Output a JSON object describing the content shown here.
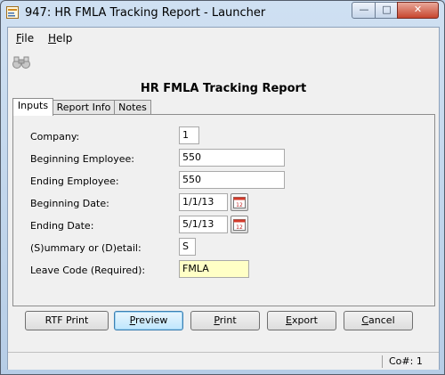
{
  "window": {
    "title": "947: HR FMLA Tracking Report - Launcher",
    "min_glyph": "—",
    "max_glyph": "□",
    "close_glyph": "✕"
  },
  "menu": {
    "file": {
      "key": "F",
      "rest": "ile"
    },
    "help": {
      "key": "H",
      "rest": "elp"
    }
  },
  "report_title": "HR FMLA Tracking Report",
  "tabs": [
    {
      "label": "Inputs"
    },
    {
      "label": "Report Info"
    },
    {
      "label": "Notes"
    }
  ],
  "inputs": {
    "company": {
      "label": "Company:",
      "value": "1"
    },
    "beginning_employee": {
      "label": "Beginning Employee:",
      "value": "550"
    },
    "ending_employee": {
      "label": "Ending Employee:",
      "value": "550"
    },
    "beginning_date": {
      "label": "Beginning Date:",
      "value": "1/1/13"
    },
    "ending_date": {
      "label": "Ending Date:",
      "value": "5/1/13"
    },
    "summary_detail": {
      "label": "(S)ummary or (D)etail:",
      "value": "S"
    },
    "leave_code": {
      "label": "Leave Code (Required):",
      "value": "FMLA"
    }
  },
  "buttons": {
    "rtf_print": {
      "label": "RTF Print"
    },
    "preview": {
      "key": "P",
      "rest": "review"
    },
    "print": {
      "key": "P",
      "rest": "rint"
    },
    "export": {
      "key": "E",
      "rest": "xport"
    },
    "cancel": {
      "key": "C",
      "rest": "ancel"
    }
  },
  "status": {
    "company": "Co#: 1"
  },
  "icons": {
    "app": "app-icon",
    "toolbar": "binoculars-icon",
    "calendar": "calendar-icon"
  },
  "colors": {
    "title_bg": "#b9d1ea",
    "close_button": "#c7452e",
    "required_field": "#ffffc6",
    "focus_button": "#3c7fb1"
  }
}
